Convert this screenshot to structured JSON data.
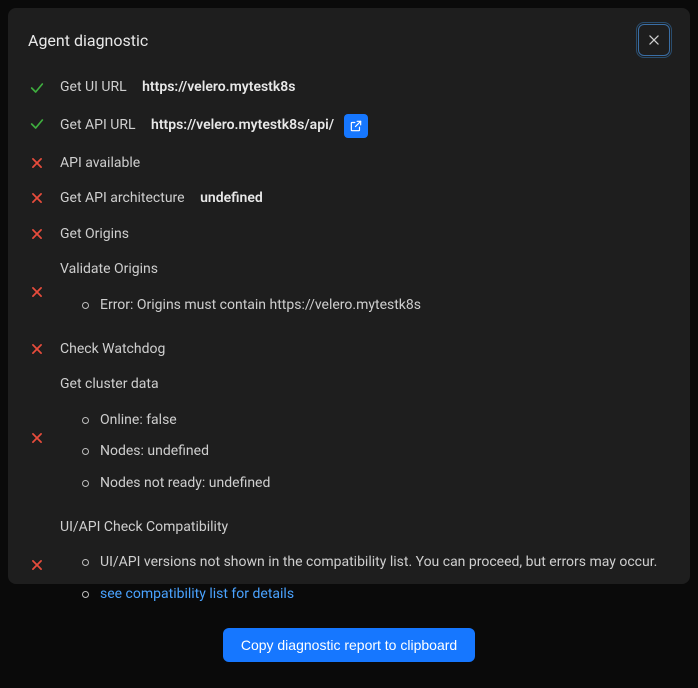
{
  "dialog": {
    "title": "Agent diagnostic"
  },
  "rows": {
    "ui_url": {
      "label": "Get UI URL",
      "value": "https://velero.mytestk8s"
    },
    "api_url": {
      "label": "Get API URL",
      "value": "https://velero.mytestk8s/api/"
    },
    "api_available": {
      "label": "API available"
    },
    "api_arch": {
      "label": "Get API architecture",
      "value": "undefined"
    },
    "get_origins": {
      "label": "Get Origins"
    },
    "validate_origins": {
      "label": "Validate Origins",
      "error": "Error: Origins must contain https://velero.mytestk8s"
    },
    "check_watchdog": {
      "label": "Check Watchdog"
    },
    "cluster_data": {
      "label": "Get cluster data",
      "online": "Online: false",
      "nodes": "Nodes: undefined",
      "nodes_not_ready": "Nodes not ready: undefined"
    },
    "compat": {
      "label": "UI/API Check Compatibility",
      "msg": "UI/API versions not shown in the compatibility list. You can proceed, but errors may occur.",
      "link": "see compatibility list for details"
    }
  },
  "footer": {
    "copy_label": "Copy diagnostic report to clipboard"
  }
}
